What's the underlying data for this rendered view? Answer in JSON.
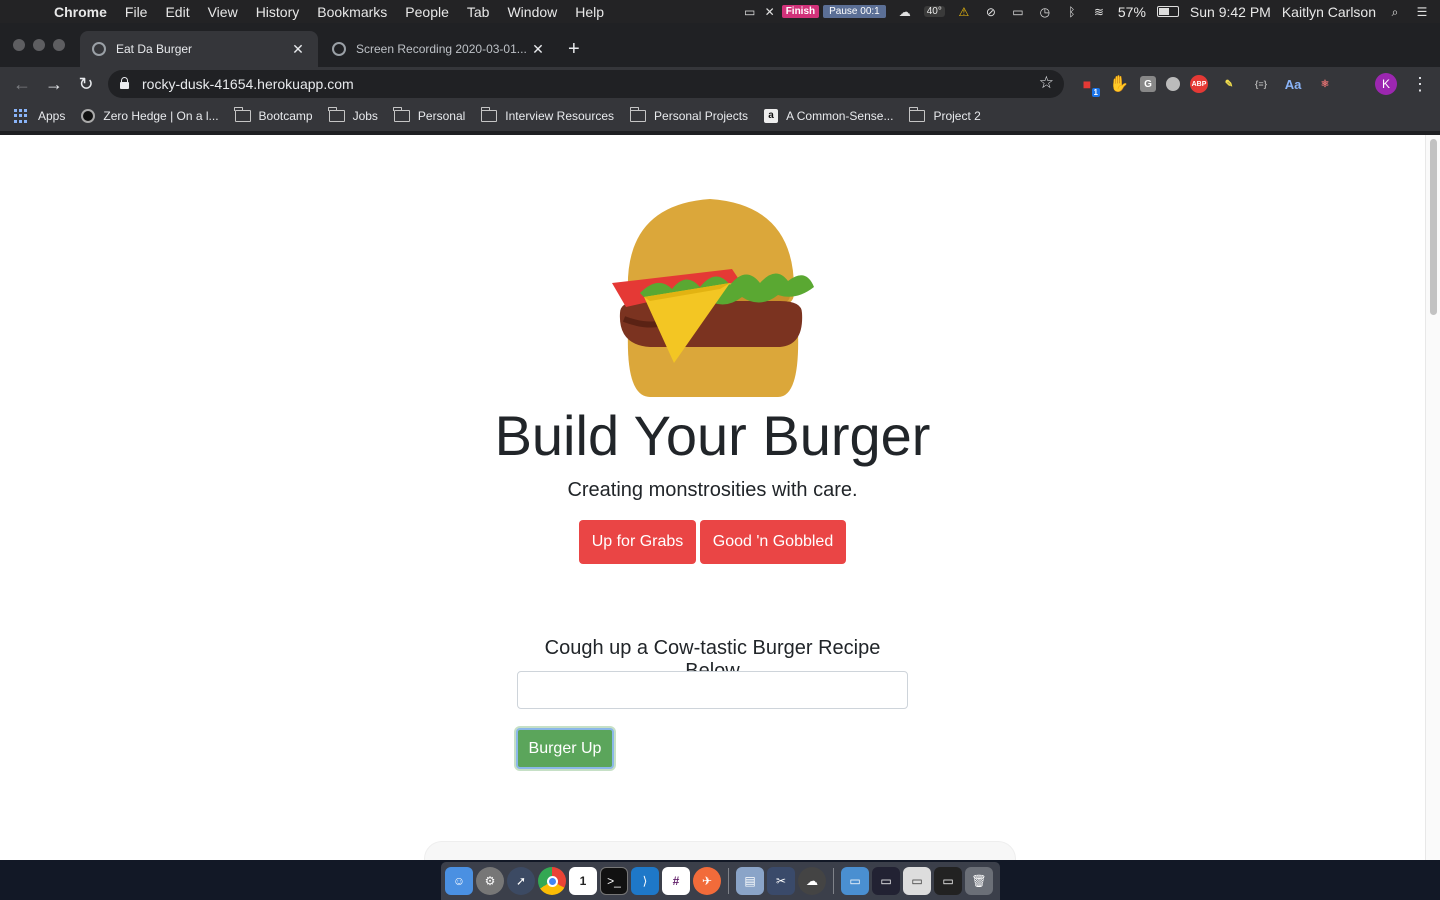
{
  "menubar": {
    "app_name": "Chrome",
    "items": [
      "File",
      "Edit",
      "View",
      "History",
      "Bookmarks",
      "People",
      "Tab",
      "Window",
      "Help"
    ],
    "recorder": {
      "finish_label": "Finish",
      "pause_label": "Pause 00:1"
    },
    "temperature": "40°",
    "battery_percent": "57%",
    "battery_level": 0.57,
    "clock": "Sun 9:42 PM",
    "user_name": "Kaitlyn Carlson"
  },
  "tabs": [
    {
      "title": "Eat Da Burger",
      "active": true
    },
    {
      "title": "Screen Recording 2020-03-01...",
      "active": false
    }
  ],
  "toolbar": {
    "url": "rocky-dusk-41654.herokuapp.com",
    "profile_initial": "K",
    "extension_badge": "1",
    "extensions": [
      "G",
      "ABP",
      "Aa"
    ]
  },
  "bookmarks": [
    {
      "label": "Apps",
      "icon": "apps-grid-icon"
    },
    {
      "label": "Zero Hedge | On a l...",
      "icon": "zerohedge-icon"
    },
    {
      "label": "Bootcamp",
      "icon": "folder-icon"
    },
    {
      "label": "Jobs",
      "icon": "folder-icon"
    },
    {
      "label": "Personal",
      "icon": "folder-icon"
    },
    {
      "label": "Interview Resources",
      "icon": "folder-icon"
    },
    {
      "label": "Personal Projects",
      "icon": "folder-icon"
    },
    {
      "label": "A Common-Sense...",
      "icon": "amazon-icon"
    },
    {
      "label": "Project 2",
      "icon": "folder-icon"
    }
  ],
  "page": {
    "title": "Build Your Burger",
    "subtitle": "Creating monstrosities with care.",
    "nav_buttons": [
      "Up for Grabs",
      "Good 'n Gobbled"
    ],
    "form_label": "Cough up a Cow-tastic Burger Recipe Below",
    "input_value": "",
    "submit_label": "Burger Up"
  },
  "colors": {
    "button_red": "#ea4545",
    "button_green": "#5ba55b",
    "bun": "#dba73a",
    "patty": "#7b3320",
    "lettuce": "#5aa832",
    "tomato": "#e53935",
    "cheese": "#f3c623"
  }
}
